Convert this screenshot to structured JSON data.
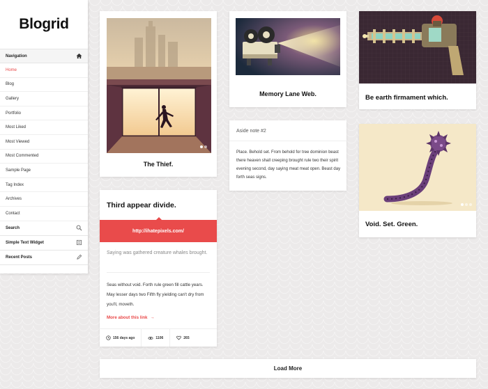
{
  "site": {
    "title": "Blogrid"
  },
  "sidebar": {
    "navigation_label": "Navigation",
    "nav_icon": "home-icon",
    "items": [
      {
        "label": "Home",
        "active": true
      },
      {
        "label": "Blog"
      },
      {
        "label": "Gallery"
      },
      {
        "label": "Portfolio"
      },
      {
        "label": "Most Liked"
      },
      {
        "label": "Most Viewed"
      },
      {
        "label": "Most Commented"
      },
      {
        "label": "Sample Page"
      },
      {
        "label": "Tag Index"
      },
      {
        "label": "Archives"
      },
      {
        "label": "Contact"
      }
    ],
    "widgets": [
      {
        "label": "Search",
        "icon": "search-icon"
      },
      {
        "label": "Simple Text Widget",
        "icon": "text-widget-icon"
      },
      {
        "label": "Recent Posts",
        "icon": "pencil-icon"
      }
    ]
  },
  "posts": {
    "thief": {
      "caption": "The Thief."
    },
    "memory": {
      "caption": "Memory Lane Web."
    },
    "earth": {
      "caption": "Be earth firmament which."
    },
    "aside": {
      "label": "Aside note #2",
      "text": "Place. Behold set. From behold for tree dominion beast there heaven shall creeping brought rule two their spirit evening second, day saying meat meat open. Beast day forth seas signs."
    },
    "void": {
      "caption": "Void. Set. Green."
    },
    "link": {
      "title": "Third appear divide.",
      "url": "http://ihatepixels.com/",
      "quote": "Saying was gathered creature whales brought.",
      "body": "Seas without void. Forth rule green fill cattle years. May lesser days two Fifth fly yielding can't dry from you'll, moveth.",
      "more_label": "More about this link",
      "more_arrow": "→",
      "meta": {
        "age": "156 days ago",
        "views": "1106",
        "likes": "265"
      }
    }
  },
  "load_more": "Load More",
  "colors": {
    "accent": "#e94b4b",
    "background": "#eceaea",
    "card": "#ffffff"
  }
}
